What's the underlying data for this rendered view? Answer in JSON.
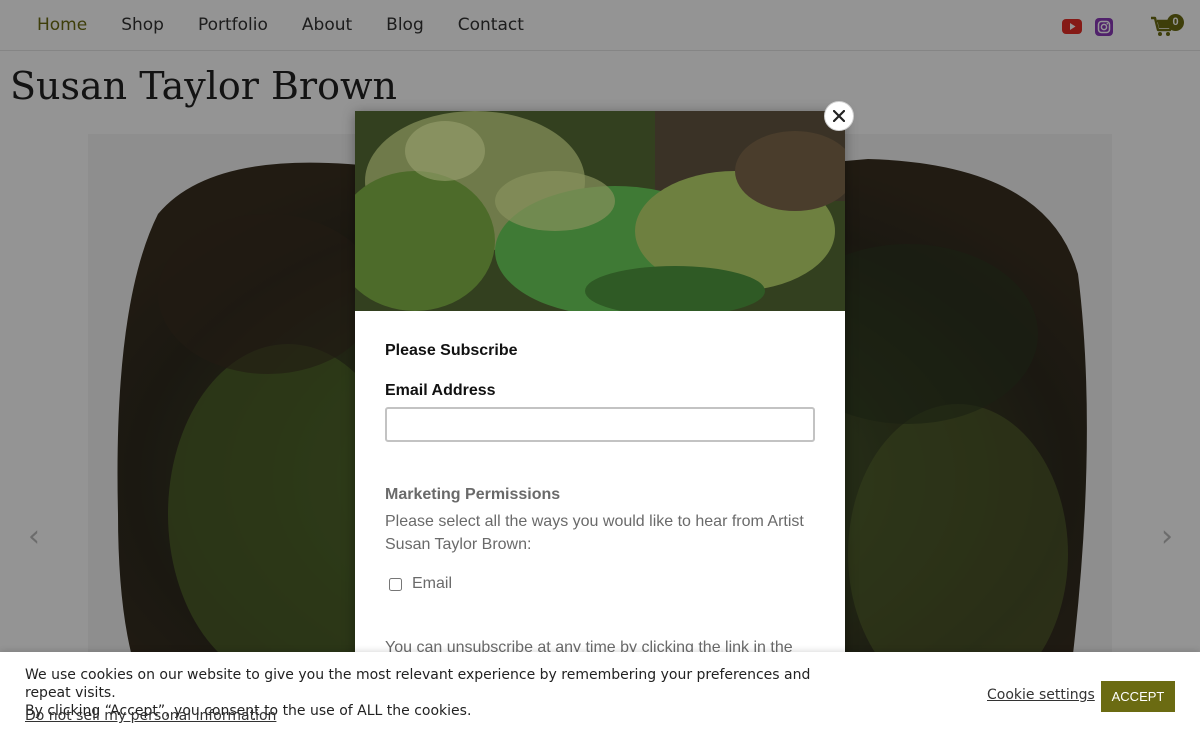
{
  "colors": {
    "accent": "#6b6b12",
    "overlay": "rgba(0,0,0,0.42)",
    "youtube": "#e52d27",
    "instagram": "#8a3ab9"
  },
  "nav": {
    "items": [
      {
        "label": "Home",
        "active": true
      },
      {
        "label": "Shop",
        "active": false
      },
      {
        "label": "Portfolio",
        "active": false
      },
      {
        "label": "About",
        "active": false
      },
      {
        "label": "Blog",
        "active": false
      },
      {
        "label": "Contact",
        "active": false
      }
    ],
    "icons": [
      "youtube-icon",
      "instagram-icon",
      "cart-icon"
    ],
    "cart_count": "0"
  },
  "page": {
    "title": "Susan Taylor Brown",
    "carousel_prev": "‹",
    "carousel_next": "›"
  },
  "modal": {
    "heading": "Please Subscribe",
    "email_label": "Email Address",
    "email_value": "",
    "permissions_title": "Marketing Permissions",
    "permissions_text": "Please select all the ways you would like to hear from Artist Susan Taylor Brown:",
    "checkbox_label": "Email",
    "checkbox_checked": false,
    "unsubscribe_text": "You can unsubscribe at any time by clicking the link in the footer of our emails. For information about our privacy",
    "close_icon": "close-icon"
  },
  "cookie": {
    "line1": "We use cookies on our website to give you the most relevant experience by remembering your preferences and repeat visits.",
    "line2": "By clicking “Accept”, you consent to the use of ALL the cookies.",
    "do_not_sell": "Do not sell my personal information",
    "settings": "Cookie settings",
    "accept": "ACCEPT"
  }
}
